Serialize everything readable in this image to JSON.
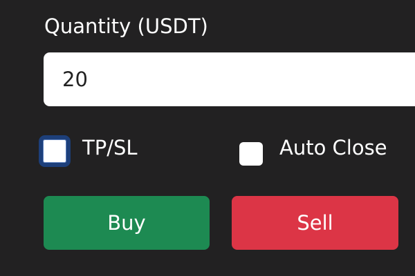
{
  "order_form": {
    "quantity_label": "Quantity (USDT)",
    "quantity_value": "20",
    "options": [
      {
        "label": "TP/SL",
        "checked": false,
        "focused": true
      },
      {
        "label": "Auto Close",
        "checked": false,
        "focused": false
      }
    ],
    "buy_label": "Buy",
    "sell_label": "Sell"
  },
  "colors": {
    "background": "#222122",
    "buy": "#1d8a52",
    "sell": "#dc3546",
    "focus_ring": "#1d3f7a"
  }
}
